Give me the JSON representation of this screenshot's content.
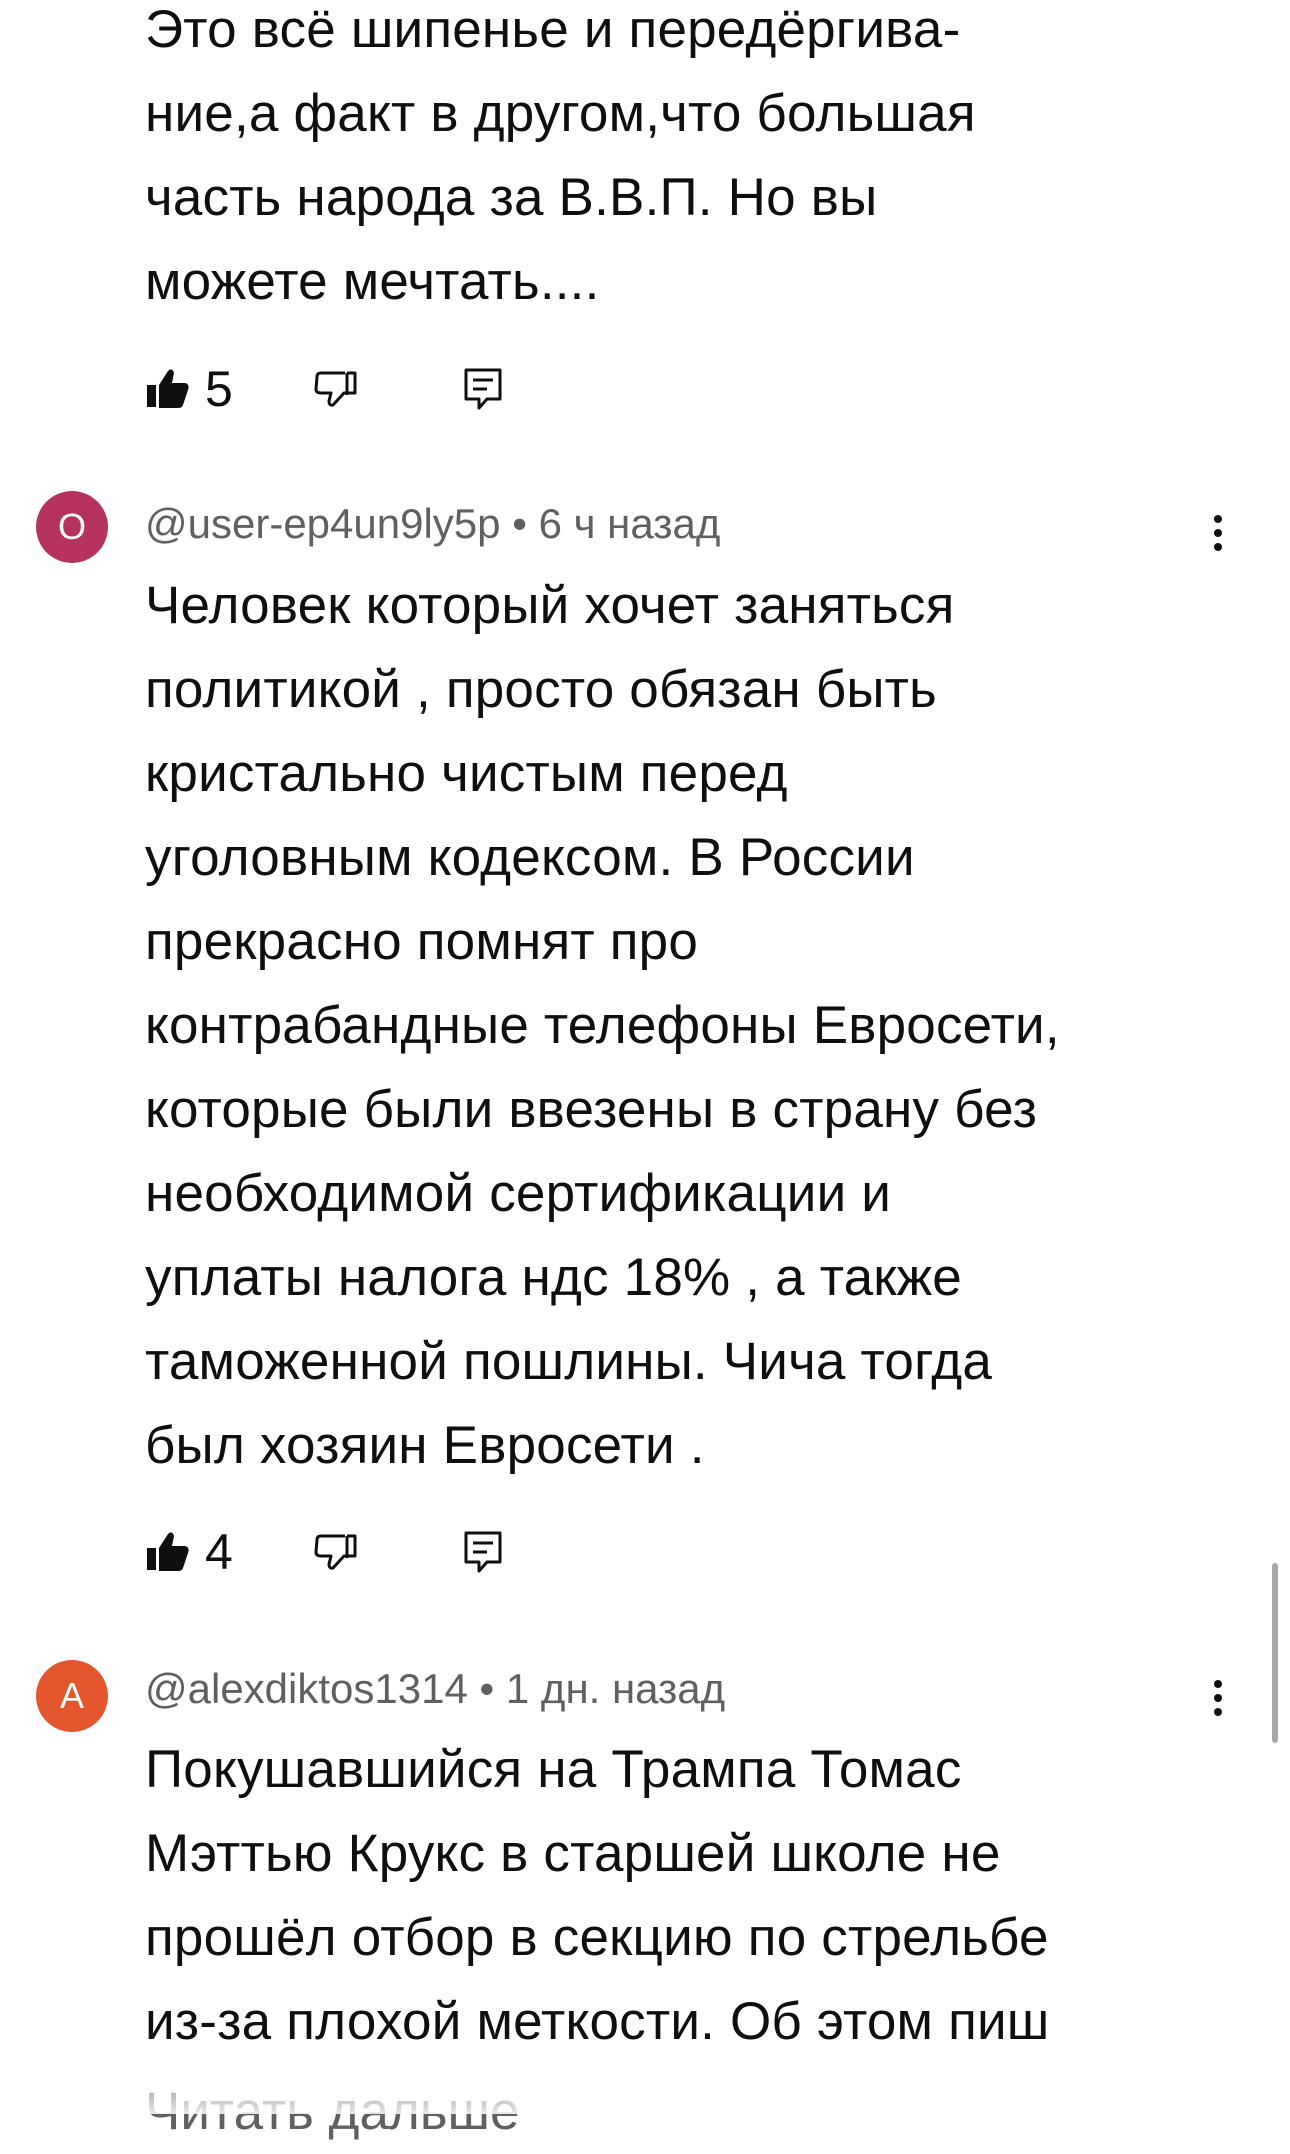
{
  "comments": [
    {
      "text": "Это всё шипенье и передёргива-\nние,а факт в другом,что большая\nчасть народа за В.В.П. Но вы\nможете мечтать....",
      "likes": "5"
    },
    {
      "avatar_letter": "О",
      "avatar_color": "#b5335d",
      "author": "@user-ep4un9ly5p",
      "time": "6 ч назад",
      "text": "Человек который хочет заняться\nполитикой , просто обязан быть\nкристально чистым перед\nуголовным кодексом. В России\nпрекрасно помнят про\nконтрабандные телефоны Евросети,\nкоторые были ввезены в страну без\nнеобходимой сертификации и\nуплаты налога ндс 18% , а также\nтаможенной пошлины. Чича тогда\nбыл хозяин Евросети .",
      "likes": "4"
    },
    {
      "avatar_letter": "А",
      "avatar_color": "#e4572e",
      "author": "@alexdiktos1314",
      "time": "1 дн. назад",
      "text": "Покушавшийся на Трампа Томас\nМэттью Крукс в старшей школе не\nпрошёл отбор в секцию по стрельбе\nиз-за плохой меткости. Об этом пиш",
      "read_more": "Читать дальше"
    }
  ],
  "icons": {
    "like": "thumbs-up-filled-icon",
    "dislike": "thumbs-down-outline-icon",
    "reply": "reply-comment-icon",
    "menu": "more-vert-icon"
  },
  "separator": "•"
}
